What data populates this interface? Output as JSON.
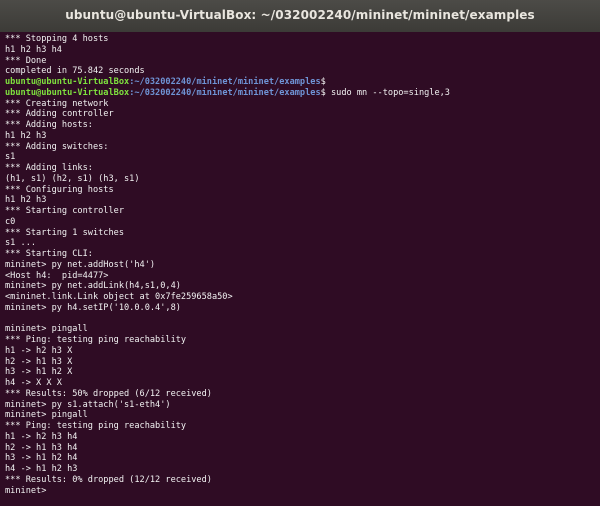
{
  "window": {
    "title": "ubuntu@ubuntu-VirtualBox: ~/032002240/mininet/mininet/examples"
  },
  "terminal": {
    "prompt": {
      "user": "ubuntu@ubuntu-VirtualBox",
      "path": ":~/032002240/mininet/mininet/examples",
      "sign": "$"
    },
    "lines": [
      {
        "type": "text",
        "text": "*** Stopping 4 hosts"
      },
      {
        "type": "text",
        "text": "h1 h2 h3 h4"
      },
      {
        "type": "text",
        "text": "*** Done"
      },
      {
        "type": "text",
        "text": "completed in 75.842 seconds"
      },
      {
        "type": "prompt",
        "cmd": ""
      },
      {
        "type": "prompt",
        "cmd": " sudo mn --topo=single,3"
      },
      {
        "type": "text",
        "text": "*** Creating network"
      },
      {
        "type": "text",
        "text": "*** Adding controller"
      },
      {
        "type": "text",
        "text": "*** Adding hosts:"
      },
      {
        "type": "text",
        "text": "h1 h2 h3"
      },
      {
        "type": "text",
        "text": "*** Adding switches:"
      },
      {
        "type": "text",
        "text": "s1"
      },
      {
        "type": "text",
        "text": "*** Adding links:"
      },
      {
        "type": "text",
        "text": "(h1, s1) (h2, s1) (h3, s1)"
      },
      {
        "type": "text",
        "text": "*** Configuring hosts"
      },
      {
        "type": "text",
        "text": "h1 h2 h3"
      },
      {
        "type": "text",
        "text": "*** Starting controller"
      },
      {
        "type": "text",
        "text": "c0"
      },
      {
        "type": "text",
        "text": "*** Starting 1 switches"
      },
      {
        "type": "text",
        "text": "s1 ..."
      },
      {
        "type": "text",
        "text": "*** Starting CLI:"
      },
      {
        "type": "text",
        "text": "mininet> py net.addHost('h4')"
      },
      {
        "type": "text",
        "text": "<Host h4:  pid=4477>"
      },
      {
        "type": "text",
        "text": "mininet> py net.addLink(h4,s1,0,4)"
      },
      {
        "type": "text",
        "text": "<mininet.link.Link object at 0x7fe259658a50>"
      },
      {
        "type": "text",
        "text": "mininet> py h4.setIP('10.0.0.4',8)"
      },
      {
        "type": "text",
        "text": ""
      },
      {
        "type": "text",
        "text": "mininet> pingall"
      },
      {
        "type": "text",
        "text": "*** Ping: testing ping reachability"
      },
      {
        "type": "text",
        "text": "h1 -> h2 h3 X"
      },
      {
        "type": "text",
        "text": "h2 -> h1 h3 X"
      },
      {
        "type": "text",
        "text": "h3 -> h1 h2 X"
      },
      {
        "type": "text",
        "text": "h4 -> X X X"
      },
      {
        "type": "text",
        "text": "*** Results: 50% dropped (6/12 received)"
      },
      {
        "type": "text",
        "text": "mininet> py s1.attach('s1-eth4')"
      },
      {
        "type": "text",
        "text": "mininet> pingall"
      },
      {
        "type": "text",
        "text": "*** Ping: testing ping reachability"
      },
      {
        "type": "text",
        "text": "h1 -> h2 h3 h4"
      },
      {
        "type": "text",
        "text": "h2 -> h1 h3 h4"
      },
      {
        "type": "text",
        "text": "h3 -> h1 h2 h4"
      },
      {
        "type": "text",
        "text": "h4 -> h1 h2 h3"
      },
      {
        "type": "text",
        "text": "*** Results: 0% dropped (12/12 received)"
      },
      {
        "type": "text",
        "text": "mininet> "
      }
    ]
  },
  "colors": {
    "terminal_bg": "#2f0c24",
    "titlebar_bg": "#3c3b37",
    "prompt_user": "#7fe13e",
    "prompt_path": "#6f94d6",
    "text": "#f2f2f2"
  }
}
